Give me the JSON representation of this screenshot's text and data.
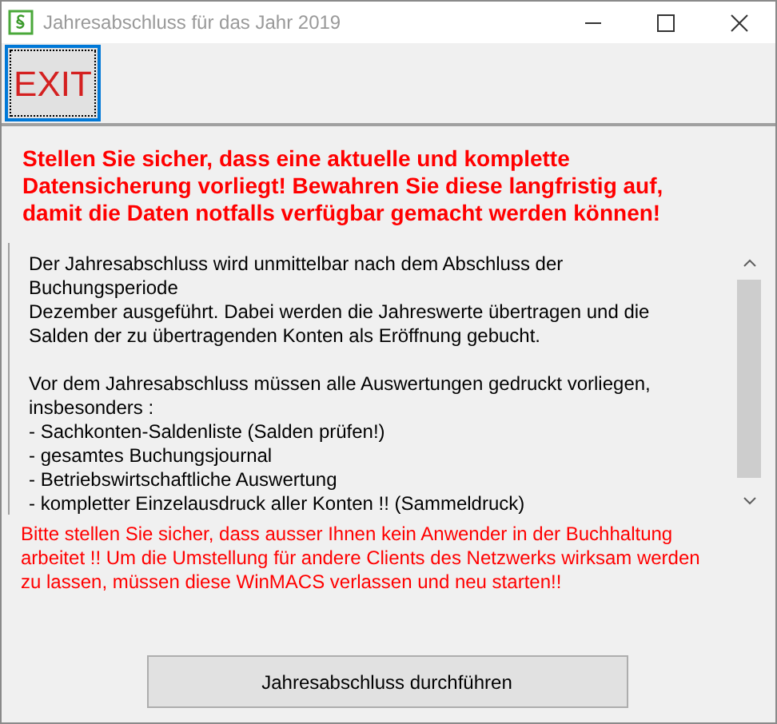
{
  "window": {
    "title": "Jahresabschluss für das Jahr 2019"
  },
  "toolbar": {
    "exit_button": "EXIT"
  },
  "warning": "Stellen Sie sicher, dass eine aktuelle und komplette Datensicherung vorliegt! Bewahren Sie diese langfristig auf, damit die Daten notfalls verfügbar gemacht werden können!",
  "info_text": {
    "paragraphs": [
      [
        "Der Jahresabschluss wird unmittelbar nach dem Abschluss der",
        "Buchungsperiode",
        "Dezember ausgeführt. Dabei werden die Jahreswerte übertragen und die",
        "Salden der zu übertragenden Konten als Eröffnung gebucht."
      ],
      [
        "Vor dem Jahresabschluss müssen alle Auswertungen gedruckt vorliegen,",
        "insbesonders :",
        "- Sachkonten-Saldenliste (Salden prüfen!)",
        "- gesamtes Buchungsjournal",
        "- Betriebswirtschaftliche Auswertung",
        "- kompletter Einzelausdruck aller Konten !! (Sammeldruck)"
      ]
    ]
  },
  "notice": "Bitte stellen Sie sicher, dass ausser Ihnen kein Anwender in der Buchhaltung arbeitet !! Um die Umstellung für andere Clients des Netzwerks wirksam werden zu lassen, müssen diese WinMACS verlassen und neu starten!!",
  "action_button": "Jahresabschluss durchführen"
}
